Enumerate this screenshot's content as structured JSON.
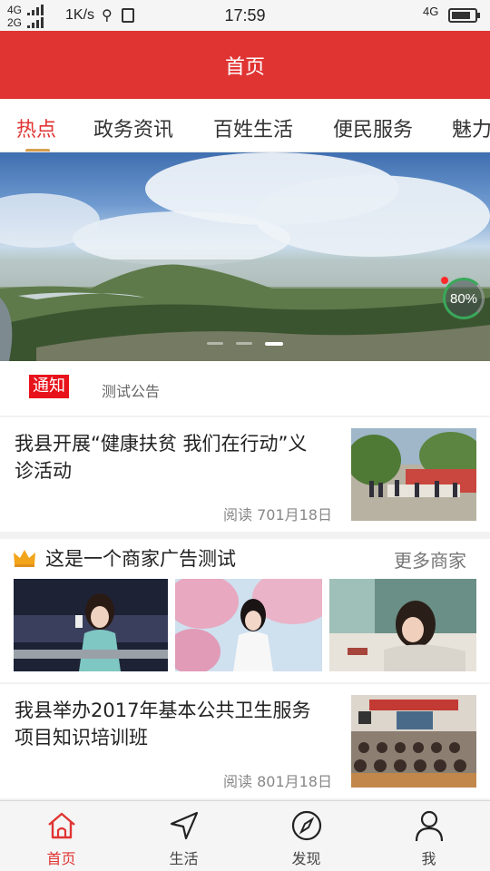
{
  "status_bar": {
    "net_top": "4G",
    "net_bottom": "2G",
    "speed": "1K/s",
    "time": "17:59",
    "net_right": "4G"
  },
  "header": {
    "title": "首页"
  },
  "tabs": [
    {
      "label": "热点",
      "active": true
    },
    {
      "label": "政务资讯",
      "active": false
    },
    {
      "label": "百姓生活",
      "active": false
    },
    {
      "label": "便民服务",
      "active": false
    },
    {
      "label": "魅力",
      "active": false
    }
  ],
  "banner": {
    "progress": "80%",
    "active_dot": 2
  },
  "notice": {
    "tag": "通知",
    "text": "测试公告"
  },
  "news": [
    {
      "title": "我县开展“健康扶贫 我们在行动”义诊活动",
      "meta": "阅读 701月18日"
    },
    {
      "title": "我县举办2017年基本公共卫生服务项目知识培训班",
      "meta": "阅读 801月18日"
    }
  ],
  "ad": {
    "title": "这是一个商家广告测试",
    "more": "更多商家"
  },
  "tabbar": [
    {
      "label": "首页",
      "icon": "home-icon",
      "active": true
    },
    {
      "label": "生活",
      "icon": "navigation-icon",
      "active": false
    },
    {
      "label": "发现",
      "icon": "compass-icon",
      "active": false
    },
    {
      "label": "我",
      "icon": "person-icon",
      "active": false
    }
  ],
  "colors": {
    "brand": "#e03433",
    "notice_tag": "#e8121b",
    "indicator": "#d9a050"
  }
}
